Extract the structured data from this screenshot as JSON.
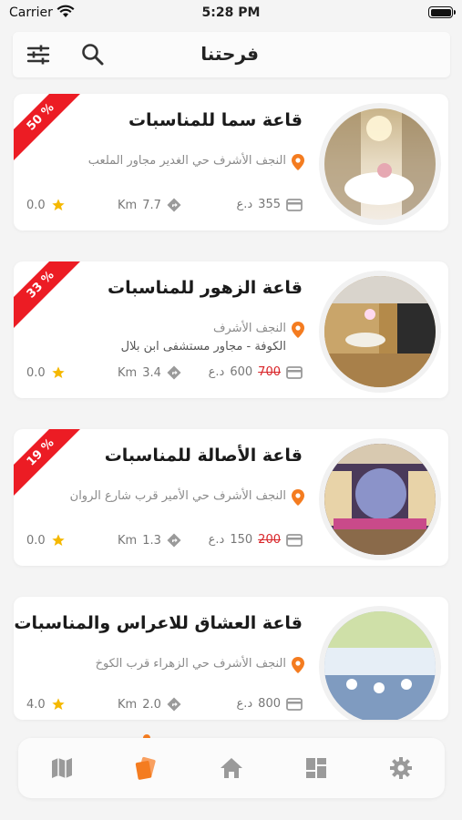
{
  "status": {
    "carrier": "Carrier",
    "time": "5:28 PM"
  },
  "header": {
    "title": "فرحتنا",
    "filter_icon": "sliders-icon",
    "search_icon": "search-icon"
  },
  "venues": [
    {
      "name": "قاعة سما للمناسبات",
      "address_line1": "النجف الأشرف حي الغدير مجاور الملعب",
      "address_line2": "",
      "rating": "0.0",
      "distance": "7.7",
      "distance_unit": "Km",
      "price": "355",
      "old_price": "",
      "currency": "د.ع",
      "discount": "50 %"
    },
    {
      "name": "قاعة الزهور للمناسبات",
      "address_line1": "النجف الأشرف",
      "address_line2": "الكوفة - مجاور مستشفى ابن بلال",
      "rating": "0.0",
      "distance": "3.4",
      "distance_unit": "Km",
      "price": "600",
      "old_price": "700",
      "currency": "د.ع",
      "discount": "33 %"
    },
    {
      "name": "قاعة الأصالة للمناسبات",
      "address_line1": "النجف الأشرف حي الأمير قرب شارع الروان",
      "address_line2": "",
      "rating": "0.0",
      "distance": "1.3",
      "distance_unit": "Km",
      "price": "150",
      "old_price": "200",
      "currency": "د.ع",
      "discount": "19 %"
    },
    {
      "name": "قاعة العشاق للاعراس والمناسبات",
      "address_line1": "النجف الأشرف حي الزهراء قرب الكوخ",
      "address_line2": "",
      "rating": "4.0",
      "distance": "2.0",
      "distance_unit": "Km",
      "price": "800",
      "old_price": "",
      "currency": "د.ع",
      "discount": ""
    }
  ],
  "tabs": [
    "map-icon",
    "offers-icon",
    "home-icon",
    "dashboard-icon",
    "settings-icon"
  ],
  "colors": {
    "accent": "#f47c20",
    "ribbon": "#ec1c24",
    "star": "#f5b800"
  }
}
